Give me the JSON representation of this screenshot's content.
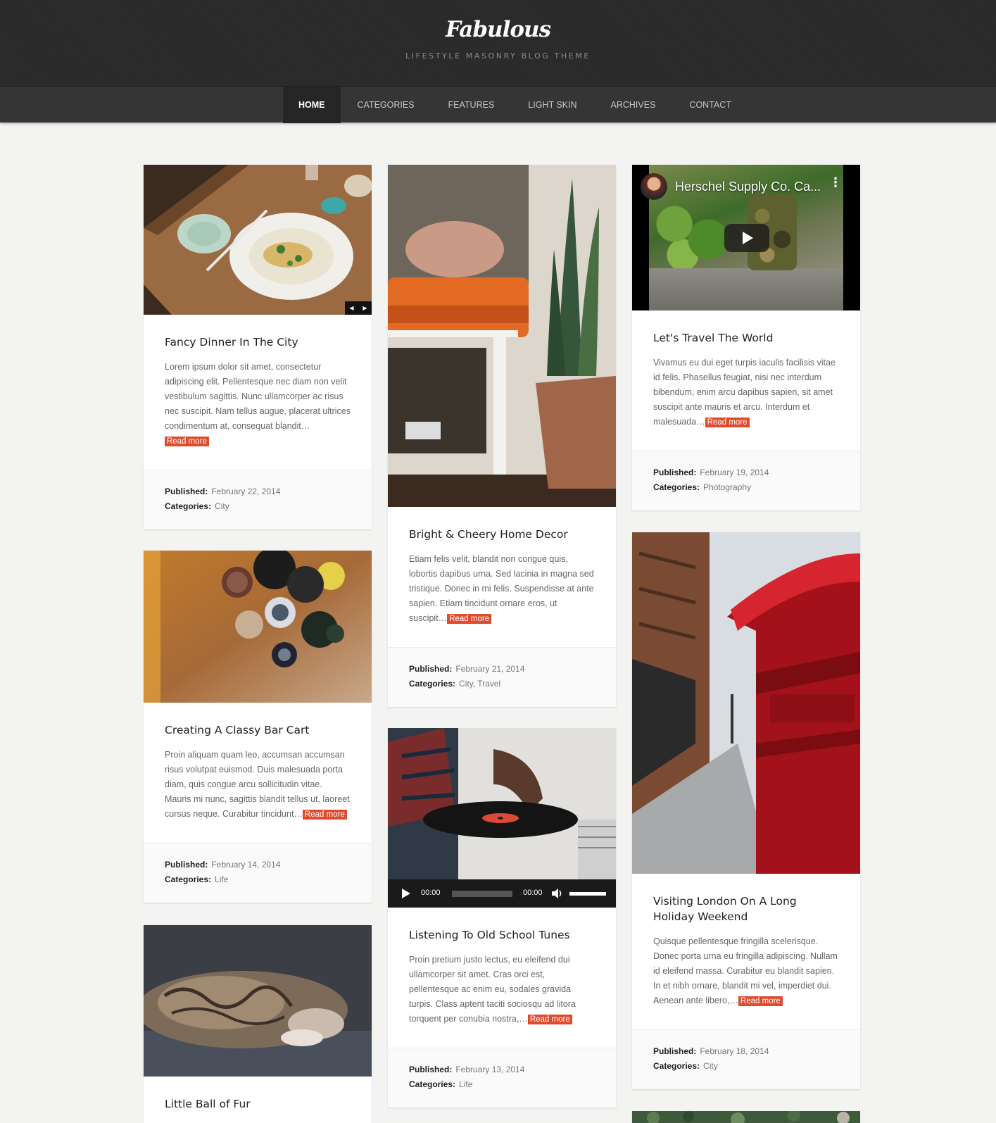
{
  "site": {
    "logo": "Fabulous",
    "tagline": "LIFESTYLE MASONRY BLOG THEME"
  },
  "nav": {
    "items": [
      "HOME",
      "CATEGORIES",
      "FEATURES",
      "LIGHT SKIN",
      "ARCHIVES",
      "CONTACT"
    ],
    "active": "HOME"
  },
  "labels": {
    "published": "Published:",
    "categories": "Categories:",
    "read_more": "Read more"
  },
  "colors": {
    "accent": "#e04b2c",
    "header_bg": "#2a2a2a",
    "nav_bg": "#353535",
    "page_bg": "#f3f3f2"
  },
  "posts": [
    {
      "title": "Fancy Dinner In The City",
      "excerpt": "Lorem ipsum dolor sit amet, consectetur adipiscing elit. Pellentesque nec diam non velit vestibulum sagittis. Nunc ullamcorper ac risus nec suscipit. Nam tellus augue, placerat ultrices condimentum at, consequat blandit…",
      "published": "February 22, 2014",
      "categories": "City",
      "media": "image-slider"
    },
    {
      "title": "Creating A Classy Bar Cart",
      "excerpt": "Proin aliquam quam leo, accumsan accumsan risus volutpat euismod. Duis malesuada porta diam, quis congue arcu sollicitudin vitae. Mauris mi nunc, sagittis blandit tellus ut, laoreet cursus neque. Curabitur tincidunt…",
      "published": "February 14, 2014",
      "categories": "Life",
      "media": "image"
    },
    {
      "title": "Little Ball of Fur",
      "media": "image"
    },
    {
      "title": "Bright & Cheery Home Decor",
      "excerpt": "Etiam felis velit, blandit non congue quis, lobortis dapibus urna. Sed lacinia in magna sed tristique. Donec in mi felis. Suspendisse at ante sapien. Etiam tincidunt ornare eros, ut suscipit…",
      "published": "February 21, 2014",
      "categories": "City, Travel",
      "media": "image"
    },
    {
      "title": "Listening To Old School Tunes",
      "excerpt": "Proin pretium justo lectus, eu eleifend dui ullamcorper sit amet. Cras orci est, pellentesque ac enim eu, sodales gravida turpis. Class aptent taciti sociosqu ad litora torquent per conubia nostra,…",
      "published": "February 13, 2014",
      "categories": "Life",
      "media": "video",
      "player": {
        "current_time": "00:00",
        "duration": "00:00"
      }
    },
    {
      "title": "Let's Travel The World",
      "excerpt": "Vivamus eu dui eget turpis iaculis facilisis vitae id felis. Phasellus feugiat, nisi nec interdum bibendum, enim arcu dapibus sapien, sit amet suscipit ante mauris et arcu. Interdum et malesuada…",
      "published": "February 19, 2014",
      "categories": "Photography",
      "media": "youtube",
      "video_title": "Herschel Supply Co. Ca..."
    },
    {
      "title": "Visiting London On A Long Holiday Weekend",
      "excerpt": "Quisque pellentesque fringilla scelerisque. Donec porta urna eu fringilla adipiscing. Nullam id eleifend massa. Curabitur eu blandit sapien. In et nibh ornare, blandit mi vel, imperdiet dui. Aenean ante libero,…",
      "published": "February 18, 2014",
      "categories": "City",
      "media": "image"
    }
  ]
}
